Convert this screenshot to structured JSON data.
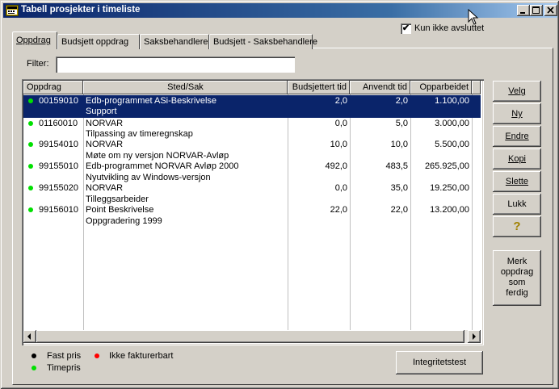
{
  "window": {
    "title": "Tabell prosjekter i timeliste"
  },
  "checkbox": {
    "label": "Kun ikke avsluttet",
    "checked": true,
    "mark": "✔"
  },
  "tabs": [
    {
      "label": "Oppdrag",
      "active": true
    },
    {
      "label": "Budsjett oppdrag"
    },
    {
      "label": "Saksbehandlere"
    },
    {
      "label": "Budsjett - Saksbehandlere"
    }
  ],
  "filter": {
    "label": "Filter:",
    "value": ""
  },
  "table": {
    "columns": [
      "Oppdrag",
      "Sted/Sak",
      "Budsjettert tid",
      "Anvendt tid",
      "Opparbeidet"
    ],
    "rows": [
      {
        "id": "00159010",
        "line1": "Edb-programmet ASi-Beskrivelse",
        "line2": "Support",
        "budsjett": "2,0",
        "anvendt": "2,0",
        "opparbeidet": "1.100,00",
        "dot": "#00e000",
        "selected": true
      },
      {
        "id": "01160010",
        "line1": "NORVAR",
        "line2": "Tilpassing av timeregnskap",
        "budsjett": "0,0",
        "anvendt": "5,0",
        "opparbeidet": "3.000,00",
        "dot": "#00e000"
      },
      {
        "id": "99154010",
        "line1": "NORVAR",
        "line2": "Møte om ny versjon NORVAR-Avløp",
        "budsjett": "10,0",
        "anvendt": "10,0",
        "opparbeidet": "5.500,00",
        "dot": "#00e000"
      },
      {
        "id": "99155010",
        "line1": "Edb-programmet NORVAR Avløp 2000",
        "line2": "Nyutvikling av Windows-versjon",
        "budsjett": "492,0",
        "anvendt": "483,5",
        "opparbeidet": "265.925,00",
        "dot": "#00e000"
      },
      {
        "id": "99155020",
        "line1": "NORVAR",
        "line2": "Tilleggsarbeider",
        "budsjett": "0,0",
        "anvendt": "35,0",
        "opparbeidet": "19.250,00",
        "dot": "#00e000"
      },
      {
        "id": "99156010",
        "line1": "Point Beskrivelse",
        "line2": "Oppgradering 1999",
        "budsjett": "22,0",
        "anvendt": "22,0",
        "opparbeidet": "13.200,00",
        "dot": "#00e000"
      }
    ]
  },
  "buttons": {
    "velg": "Velg",
    "ny": "Ny",
    "endre": "Endre",
    "kopi": "Kopi",
    "slette": "Slette",
    "lukk": "Lukk",
    "help_glyph": "?",
    "merk": [
      "Merk",
      "oppdrag",
      "som",
      "ferdig"
    ],
    "integritet": "Integritetstest"
  },
  "legend": {
    "fast_pris": {
      "label": "Fast pris",
      "color": "#000000"
    },
    "ikke_fakturerbart": {
      "label": "Ikke fakturerbart",
      "color": "#ff0000"
    },
    "timepris": {
      "label": "Timepris",
      "color": "#00e000"
    }
  }
}
